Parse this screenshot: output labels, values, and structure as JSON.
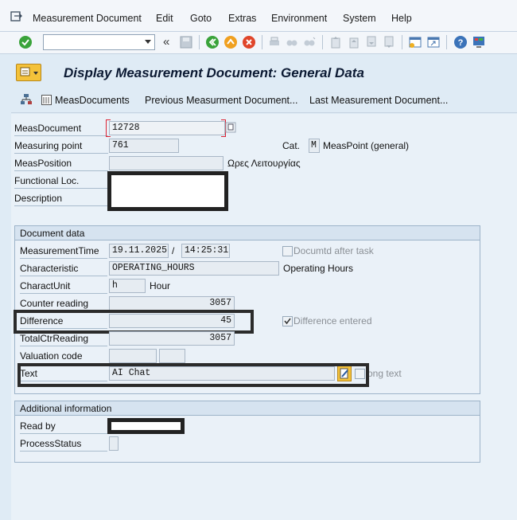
{
  "menu": [
    "Measurement Document",
    "Edit",
    "Goto",
    "Extras",
    "Environment",
    "System",
    "Help"
  ],
  "page_title": "Display Measurement Document: General Data",
  "app_toolbar": {
    "meas_documents": "MeasDocuments",
    "previous": "Previous Measurment Document...",
    "last": "Last Measurement Document..."
  },
  "header": {
    "meas_document_label": "MeasDocument",
    "meas_document_value": "12728",
    "measuring_point_label": "Measuring point",
    "measuring_point_value": "761",
    "cat_label": "Cat.",
    "cat_value": "M",
    "cat_text": "MeasPoint (general)",
    "meas_position_label": "MeasPosition",
    "meas_position_text": "Ωρες  Λειτουργίας",
    "functional_loc_label": "Functional Loc.",
    "description_label": "Description"
  },
  "document_data": {
    "title": "Document data",
    "measurement_time_label": "MeasurementTime",
    "date": "19.11.2025",
    "time": "14:25:31",
    "time_sep": "/",
    "documtd_after_task": "Documtd after task",
    "characteristic_label": "Characteristic",
    "characteristic_value": "OPERATING_HOURS",
    "characteristic_text": "Operating Hours",
    "charact_unit_label": "CharactUnit",
    "charact_unit_value": "h",
    "charact_unit_text": "Hour",
    "counter_reading_label": "Counter reading",
    "counter_reading_value": "3057",
    "difference_label": "Difference",
    "difference_value": "45",
    "difference_entered": "Difference entered",
    "total_ctr_label": "TotalCtrReading",
    "total_ctr_value": "3057",
    "valuation_code_label": "Valuation code",
    "text_label": "Text",
    "text_value": "AI Chat",
    "long_text": "ong text"
  },
  "additional_info": {
    "title": "Additional information",
    "read_by_label": "Read by",
    "process_status_label": "ProcessStatus"
  },
  "colors": {
    "accent": "#0c1a33",
    "background": "#dfebf5",
    "highlight_border": "#2b2b2b"
  }
}
